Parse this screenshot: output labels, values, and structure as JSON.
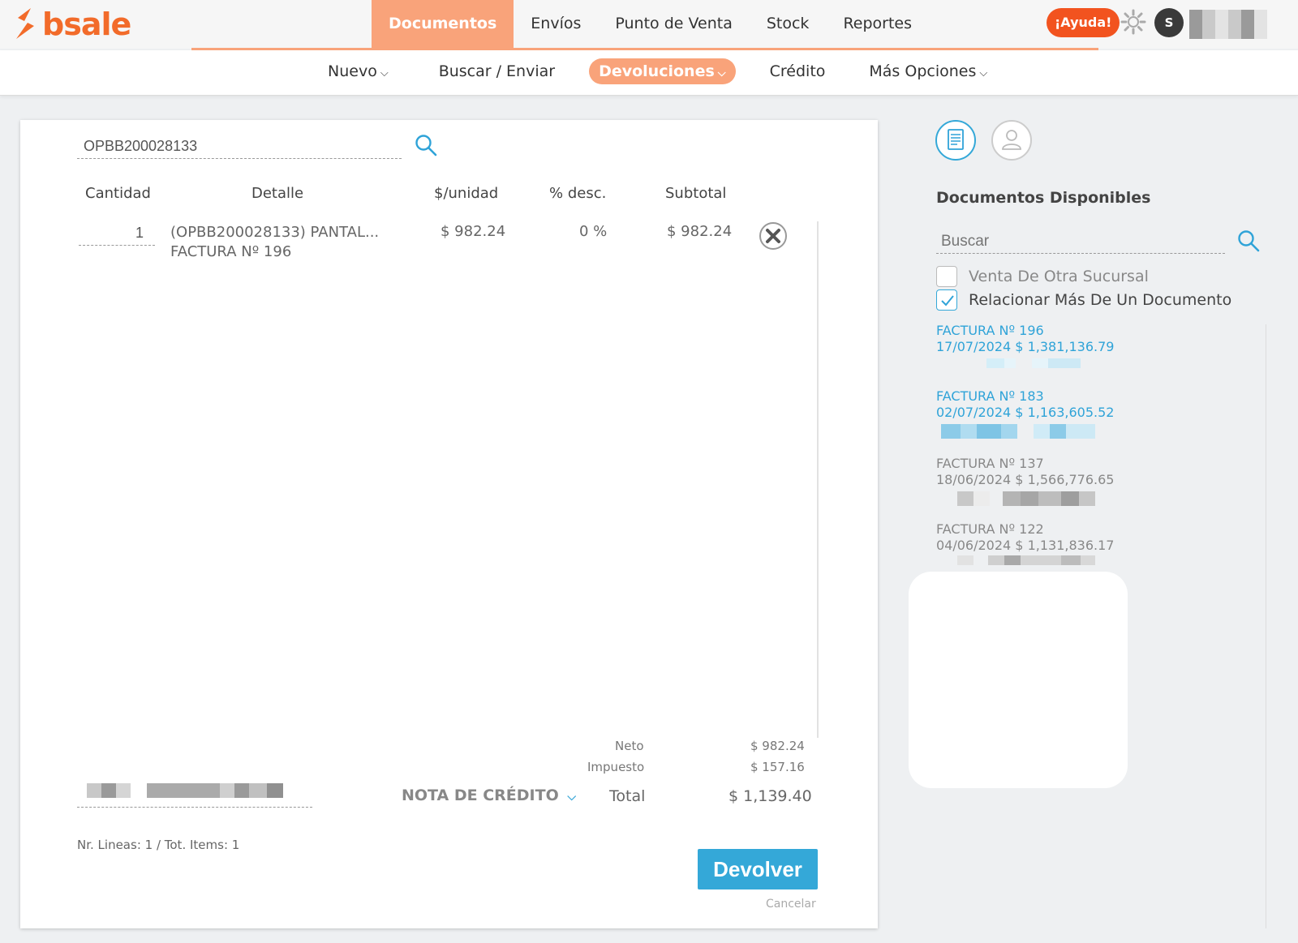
{
  "brand": {
    "name": "bsale",
    "color": "#f26b2a"
  },
  "main_nav": {
    "items": [
      {
        "label": "Documentos",
        "active": true
      },
      {
        "label": "Envíos",
        "active": false
      },
      {
        "label": "Punto de Venta",
        "active": false
      },
      {
        "label": "Stock",
        "active": false
      },
      {
        "label": "Reportes",
        "active": false
      }
    ],
    "accent": "#f9a37a"
  },
  "header": {
    "help_label": "¡Ayuda!",
    "avatar_initial": "S",
    "icons": {
      "settings": "gear-icon"
    }
  },
  "sub_nav": {
    "items": [
      {
        "label": "Nuevo",
        "has_dropdown": true,
        "active": false
      },
      {
        "label": "Buscar / Enviar",
        "has_dropdown": false,
        "active": false
      },
      {
        "label": "Devoluciones",
        "has_dropdown": true,
        "active": true
      },
      {
        "label": "Crédito",
        "has_dropdown": false,
        "active": false
      },
      {
        "label": "Más Opciones",
        "has_dropdown": true,
        "active": false
      }
    ]
  },
  "return_form": {
    "search_value": "OPBB200028133",
    "columns": [
      "Cantidad",
      "Detalle",
      "$/unidad",
      "% desc.",
      "Subtotal"
    ],
    "rows": [
      {
        "quantity": "1",
        "detail_line1": "(OPBB200028133) PANTAL...",
        "detail_line2": "FACTURA Nº 196",
        "unit_price": "$ 982.24",
        "discount": "0 %",
        "subtotal": "$ 982.24"
      }
    ],
    "totals": {
      "neto_label": "Neto",
      "neto_value": "$ 982.24",
      "impuesto_label": "Impuesto",
      "impuesto_value": "$ 157.16",
      "total_label": "Total",
      "total_value": "$ 1,139.40"
    },
    "document_type": "NOTA DE CRÉDITO",
    "lines_info": "Nr. Lineas: 1 / Tot. Items: 1",
    "submit_label": "Devolver",
    "cancel_label": "Cancelar",
    "submit_color": "#34a8d8"
  },
  "available_docs": {
    "title": "Documentos Disponibles",
    "search_placeholder": "Buscar",
    "checkboxes": [
      {
        "label": "Venta De Otra Sucursal",
        "checked": false
      },
      {
        "label": "Relacionar Más De Un Documento",
        "checked": true
      }
    ],
    "documents": [
      {
        "title": "FACTURA Nº 196",
        "date_amount": "17/07/2024 $ 1,381,136.79",
        "highlight": true
      },
      {
        "title": "FACTURA Nº 183",
        "date_amount": "02/07/2024 $ 1,163,605.52",
        "highlight": true
      },
      {
        "title": "FACTURA Nº 137",
        "date_amount": "18/06/2024 $ 1,566,776.65",
        "highlight": false
      },
      {
        "title": "FACTURA Nº 122",
        "date_amount": "04/06/2024 $ 1,131,836.17",
        "highlight": false
      }
    ]
  }
}
